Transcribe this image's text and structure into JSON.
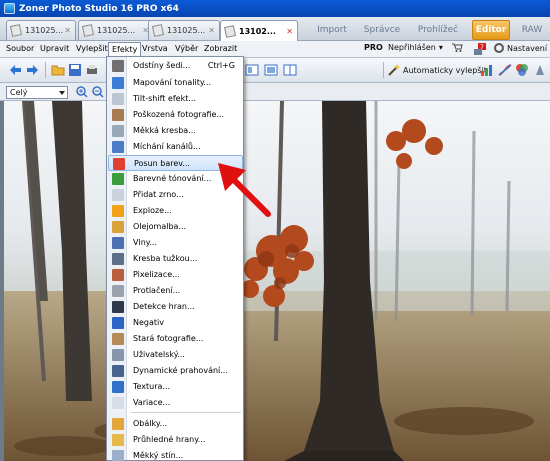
{
  "window": {
    "title": "Zoner Photo Studio 16 PRO x64"
  },
  "doc_tabs": [
    {
      "label": "131025..."
    },
    {
      "label": "131025..."
    },
    {
      "label": "131025..."
    },
    {
      "label": "13102..."
    }
  ],
  "mode_tabs": [
    "Import",
    "Správce",
    "Prohlížeč",
    "Editor",
    "RAW"
  ],
  "menu": [
    "Soubor",
    "Upravit",
    "Vylepšit",
    "Efekty",
    "Vrstva",
    "Výběr",
    "Zobrazit"
  ],
  "menu_right": {
    "pro": "PRO",
    "login": "Nepřihlášen",
    "settings": "Nastavení"
  },
  "toolbar": {
    "auto_enhance": "Automaticky vylepšit"
  },
  "zoom": {
    "value": "Celý"
  },
  "effects_menu": [
    {
      "label": "Odstíny šedi...",
      "shortcut": "Ctrl+G",
      "icon": "grayscale-icon",
      "color": "#6f6f6f"
    },
    {
      "label": "Mapování tonality...",
      "icon": "tone-mapping-icon",
      "color": "#3e7bd6"
    },
    {
      "label": "Tilt-shift efekt...",
      "icon": "tilt-shift-icon",
      "color": "#bcc6d3"
    },
    {
      "label": "Poškozená fotografie...",
      "icon": "damaged-photo-icon",
      "color": "#a77b52"
    },
    {
      "label": "Měkká kresba...",
      "icon": "soft-drawing-icon",
      "color": "#9aa7b8"
    },
    {
      "label": "Míchání kanálů...",
      "icon": "channel-mixer-icon",
      "color": "#4a7cc8"
    },
    {
      "label": "Posun barev...",
      "icon": "color-shift-icon",
      "color": "#e0402f",
      "hover": true
    },
    {
      "label": "Barevné tónování...",
      "icon": "color-toning-icon",
      "color": "#3a9c3a"
    },
    {
      "label": "Přidat zrno...",
      "icon": "add-grain-icon",
      "color": "#c9d2dc"
    },
    {
      "label": "Exploze...",
      "icon": "explosion-icon",
      "color": "#f1a21a"
    },
    {
      "label": "Olejomalba...",
      "icon": "oil-paint-icon",
      "color": "#d9a13a"
    },
    {
      "label": "Vlny...",
      "icon": "waves-icon",
      "color": "#4b6fb0"
    },
    {
      "label": "Kresba tužkou...",
      "icon": "pencil-drawing-icon",
      "color": "#5c6f86"
    },
    {
      "label": "Pixelizace...",
      "icon": "pixelize-icon",
      "color": "#b85d3d"
    },
    {
      "label": "Protlačení...",
      "icon": "emboss-icon",
      "color": "#9aa3ad"
    },
    {
      "label": "Detekce hran...",
      "icon": "edge-detect-icon",
      "color": "#2f3b4b"
    },
    {
      "label": "Negativ",
      "icon": "negative-icon",
      "color": "#2b64c5"
    },
    {
      "label": "Stará fotografie...",
      "icon": "old-photo-icon",
      "color": "#b48a55"
    },
    {
      "label": "Uživatelský...",
      "icon": "custom-filter-icon",
      "color": "#8796aa"
    },
    {
      "label": "Dynamické prahování...",
      "icon": "dynamic-threshold-icon",
      "color": "#47648f"
    },
    {
      "label": "Textura...",
      "icon": "texture-icon",
      "color": "#2f71c9"
    },
    {
      "label": "Variace...",
      "icon": "variations-icon",
      "color": "#d7dde5"
    },
    {
      "label": "Obálky...",
      "icon": "envelopes-icon",
      "color": "#e4a83a"
    },
    {
      "label": "Průhledné hrany...",
      "icon": "transparent-edges-icon",
      "color": "#e6b94a"
    },
    {
      "label": "Měkký stín...",
      "icon": "soft-shadow-icon",
      "color": "#9ab0c9"
    }
  ],
  "colors": {
    "accent_tab": "#e69a18",
    "title_bar": "#0845b0",
    "arrow": "#e01010"
  }
}
